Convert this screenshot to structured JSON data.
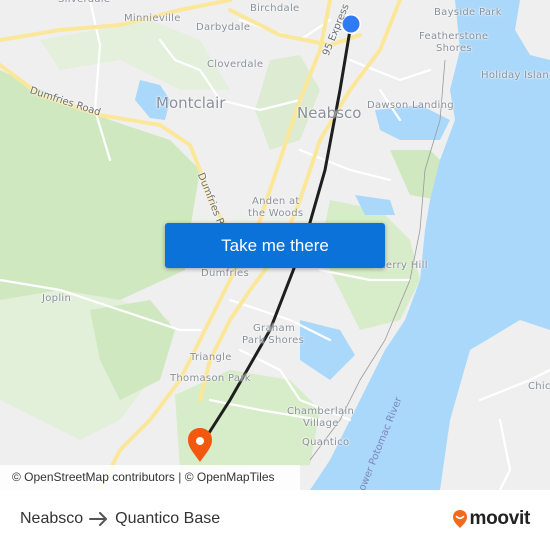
{
  "map": {
    "places": {
      "silverdale": "Silverdale",
      "minnieville": "Minnieville",
      "birchdale": "Birchdale",
      "darbydale": "Darbydale",
      "cloverdale": "Cloverdale",
      "montclair": "Montclair",
      "neabsco": "Neabsco",
      "bayside_park": "Bayside Park",
      "featherstone_shores_1": "Featherstone",
      "featherstone_shores_2": "Shores",
      "holiday_island": "Holiday Island",
      "dawson_landing": "Dawson Landing",
      "anden_1": "Anden at",
      "anden_2": "the Woods",
      "dumfries": "Dumfries",
      "cherry_hill": "Cherry Hill",
      "joplin": "Joplin",
      "graham_park_1": "Graham",
      "graham_park_2": "Park Shores",
      "triangle": "Triangle",
      "thomason_park": "Thomason Park",
      "chamberlain_1": "Chamberlain",
      "chamberlain_2": "Village",
      "quantico": "Quantico",
      "chic": "Chic"
    },
    "roads": {
      "dumfries_road_west": "Dumfries Road",
      "dumfries_road_south": "Dumfries Road",
      "express_95": "95 Express"
    },
    "rivers": {
      "potomac": "Lower Potomac River"
    },
    "markers": {
      "origin": {
        "label": "Neabsco",
        "color": "#2f7bf5"
      },
      "destination": {
        "label": "Quantico Base",
        "color": "#f2590f"
      }
    },
    "route_color": "#1e1e1e",
    "colors": {
      "land": "#efefef",
      "water": "#aad8fa",
      "park": "#cfe8c0",
      "highway": "#fbe79a",
      "road": "#ffffff"
    }
  },
  "cta": {
    "label": "Take me there"
  },
  "attribution": {
    "osm": "© OpenStreetMap contributors",
    "separator": "|",
    "omt": "© OpenMapTiles"
  },
  "footer": {
    "origin": "Neabsco",
    "destination": "Quantico Base",
    "brand": "moovit",
    "brand_color": "#f26a1b"
  }
}
